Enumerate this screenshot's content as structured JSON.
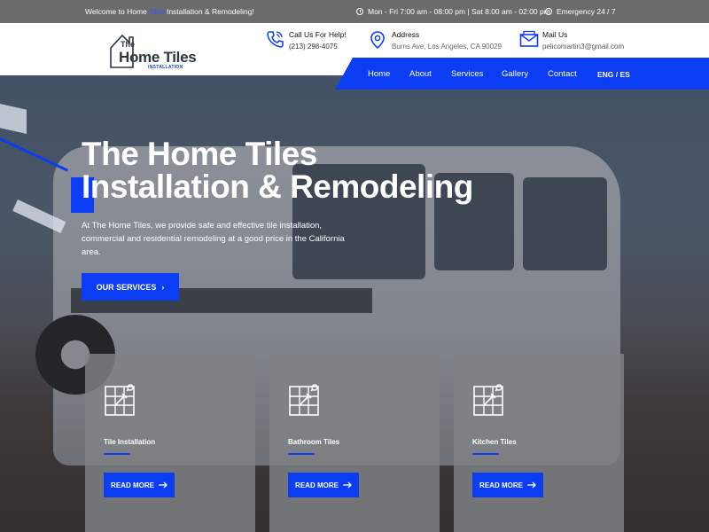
{
  "topbar": {
    "welcome_pre": "Welcome to Home ",
    "welcome_hl": "Tiles",
    "welcome_post": " Installation & Remodeling!",
    "hours": "Mon - Fri 7:00 am - 08:00 pm | Sat 8:00 am - 02:00 pm",
    "emergency": "Emergency 24 / 7"
  },
  "logo": {
    "the": "The",
    "name": "Home Tiles",
    "sub": "INSTALLATION"
  },
  "contact": {
    "call": {
      "title": "Call Us For Help!",
      "value": "(213) 298-4075"
    },
    "address": {
      "title": "Address",
      "value": "Burns Ave, Los Angeles, CA 90029"
    },
    "mail": {
      "title": "Mail Us",
      "value": "pelicomartin3@gmail.com"
    }
  },
  "nav": {
    "items": [
      "Home",
      "About",
      "Services",
      "Gallery",
      "Contact"
    ],
    "lang": "ENG / ES"
  },
  "hero": {
    "title_line1": "The Home Tiles",
    "title_line2": "Installation & Remodeling",
    "description": "At The Home Tiles, we provide safe and effective tile installation, commercial and residential remodeling at a good price in the California area.",
    "cta_label": "OUR SERVICES"
  },
  "cards": [
    {
      "title": "Tile Installation",
      "button": "READ MORE"
    },
    {
      "title": "Bathroom Tiles",
      "button": "READ MORE"
    },
    {
      "title": "Kitchen Tiles",
      "button": "READ MORE"
    }
  ],
  "colors": {
    "accent": "#0b3df5",
    "topbar": "#6b6b6b",
    "card": "#808286"
  }
}
